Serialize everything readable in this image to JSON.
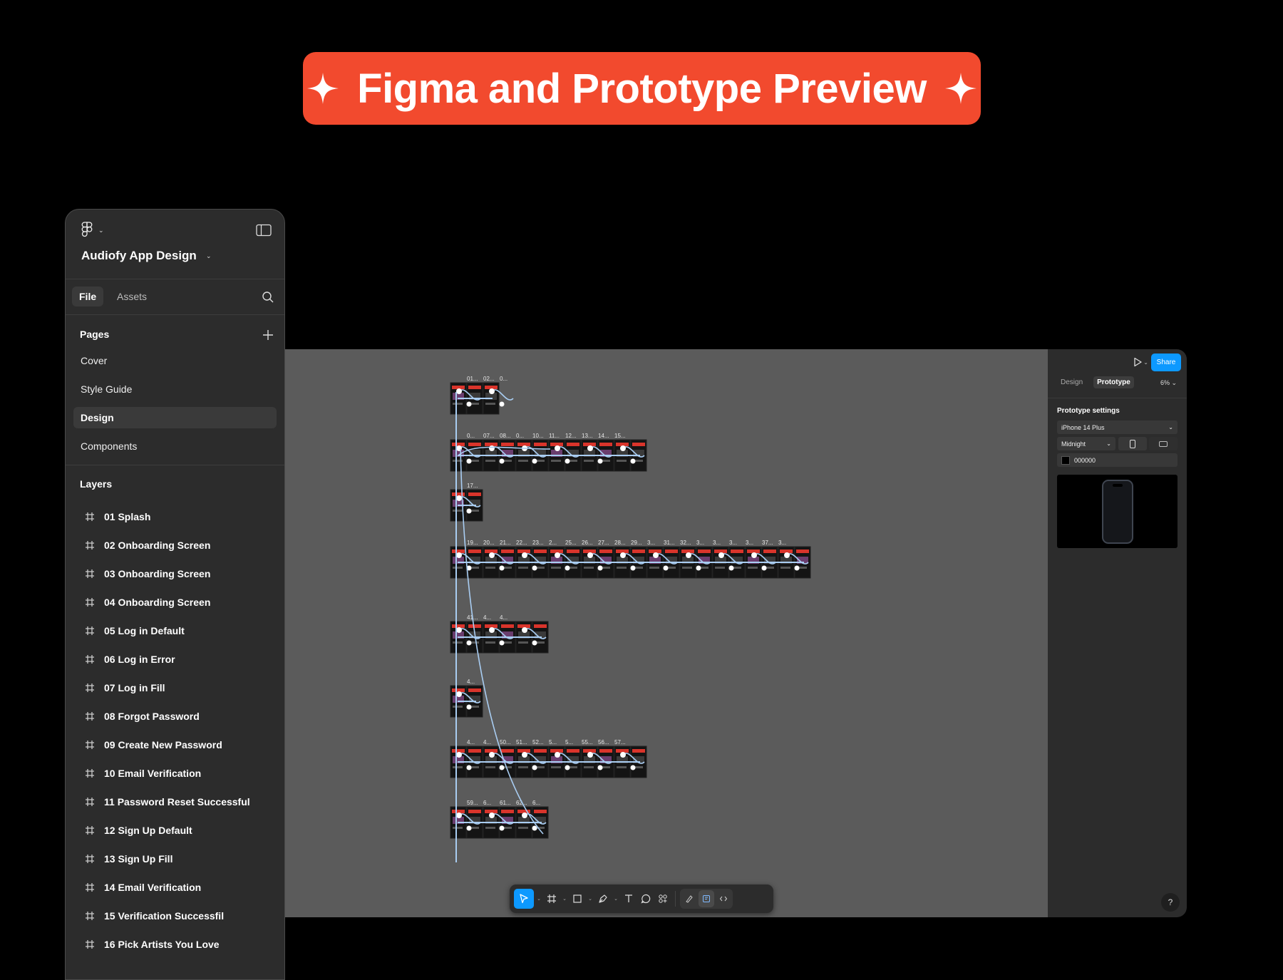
{
  "banner": {
    "title": "Figma and Prototype Preview",
    "color": "#f24a2e"
  },
  "left_panel": {
    "file_name": "Audiofy App Design",
    "tabs": [
      {
        "label": "File",
        "active": true
      },
      {
        "label": "Assets",
        "active": false
      }
    ],
    "pages_heading": "Pages",
    "pages": [
      {
        "label": "Cover",
        "active": false
      },
      {
        "label": "Style Guide",
        "active": false
      },
      {
        "label": "Design",
        "active": true
      },
      {
        "label": "Components",
        "active": false
      }
    ],
    "layers_heading": "Layers",
    "layers": [
      "01 Splash",
      "02 Onboarding Screen",
      "03 Onboarding Screen",
      "04 Onboarding Screen",
      "05 Log in Default",
      "06 Log in Error",
      "07 Log in Fill",
      "08 Forgot Password",
      "09 Create New Password",
      "10 Email Verification",
      "11 Password Reset Successful",
      "12 Sign Up Default",
      "13 Sign Up Fill",
      "14 Email Verification",
      "15 Verification Successfil",
      "16 Pick Artists You Love"
    ]
  },
  "right_panel": {
    "share_label": "Share",
    "tabs": [
      {
        "label": "Design",
        "active": false
      },
      {
        "label": "Prototype",
        "active": true
      }
    ],
    "zoom": "6%",
    "section_title": "Prototype settings",
    "device": "iPhone 14 Plus",
    "model": "Midnight",
    "background_color": "000000",
    "help": "?"
  },
  "canvas": {
    "background": "#5b5b5b",
    "flow_color": "#a9cdf2",
    "rows": [
      {
        "labels": [
          "01...",
          "02...",
          "0..."
        ],
        "frames": 3
      },
      {
        "labels": [
          "0...",
          "07...",
          "08...",
          "0...",
          "10...",
          "11...",
          "12...",
          "13...",
          "14...",
          "15..."
        ],
        "frames": 12
      },
      {
        "labels": [
          "17..."
        ],
        "frames": 2
      },
      {
        "labels": [
          "19...",
          "20...",
          "21...",
          "22...",
          "23...",
          "2...",
          "25...",
          "26...",
          "27...",
          "28...",
          "29...",
          "3...",
          "31...",
          "32...",
          "3...",
          "3...",
          "3...",
          "3...",
          "37...",
          "3..."
        ],
        "frames": 22
      },
      {
        "labels": [
          "41...",
          "4...",
          "4..."
        ],
        "frames": 6
      },
      {
        "labels": [
          "4..."
        ],
        "frames": 2
      },
      {
        "labels": [
          "4...",
          "4...",
          "50...",
          "51...",
          "52...",
          "5...",
          "5...",
          "55...",
          "56...",
          "57..."
        ],
        "frames": 12
      },
      {
        "labels": [
          "59...",
          "6...",
          "61...",
          "62...",
          "6..."
        ],
        "frames": 6
      }
    ]
  }
}
